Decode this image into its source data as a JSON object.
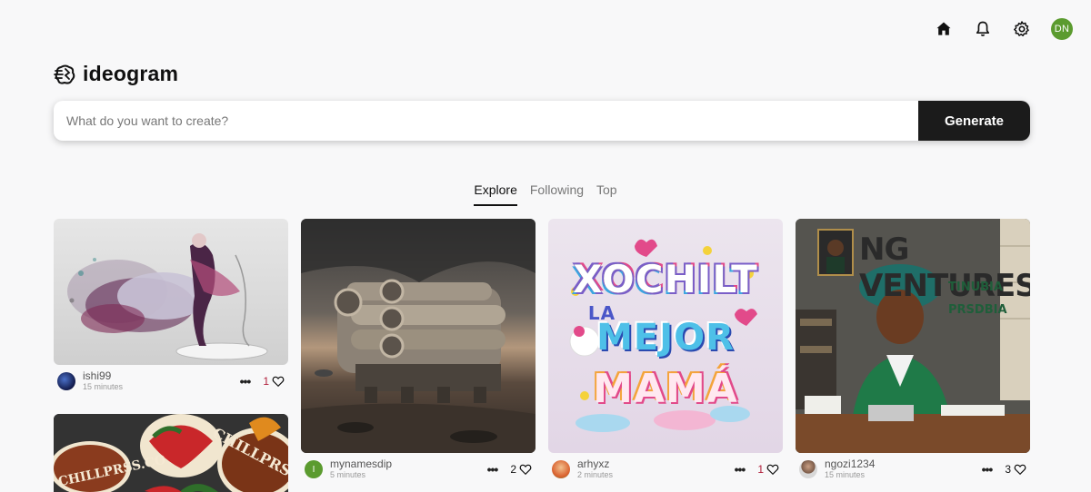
{
  "nav": {
    "user_initials": "DN",
    "icons": [
      "home-icon",
      "bell-icon",
      "gear-icon"
    ]
  },
  "brand": {
    "name": "ideogram"
  },
  "search": {
    "placeholder": "What do you want to create?",
    "value": "",
    "generate_label": "Generate"
  },
  "tabs": [
    {
      "label": "Explore",
      "active": true
    },
    {
      "label": "Following",
      "active": false
    },
    {
      "label": "Top",
      "active": false
    }
  ],
  "cards": [
    {
      "user": "ishi99",
      "time": "15 minutes",
      "likes": "1",
      "more": "•••"
    },
    {
      "user": "mynamesdip",
      "time": "5 minutes",
      "likes": "2",
      "more": "•••",
      "avatar_letter": "I"
    },
    {
      "user": "arhyxz",
      "time": "2 minutes",
      "likes": "1",
      "more": "•••"
    },
    {
      "user": "ngozi1234",
      "time": "15 minutes",
      "likes": "3",
      "more": "•••"
    }
  ],
  "image_text": {
    "chilli_1": "CHILLPRSS.CO",
    "chilli_2": "CHILLPRSS",
    "mama_1": "XOCHILT",
    "mama_2": "LA",
    "mama_3": "MEJOR",
    "mama_4": "MAMÁ",
    "ng_title": "NG VENTURES",
    "ng_sub1": "TINUBIA",
    "ng_sub2": "PRSDBIA"
  },
  "colors": {
    "accent_dark": "#1b1b1b",
    "avatar_green": "#5b9b2f",
    "background": "#f8f8f9"
  }
}
